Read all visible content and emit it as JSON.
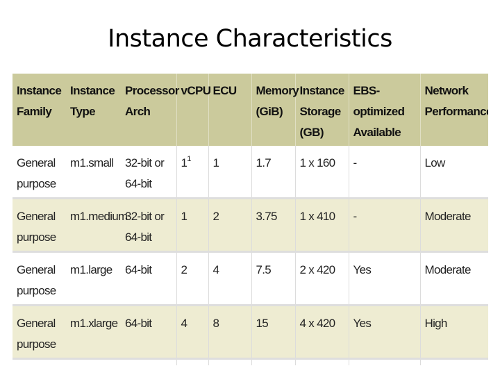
{
  "slide": {
    "title": "Instance Characteristics"
  },
  "table": {
    "headers": [
      "Instance Family",
      "Instance Type",
      "Processor Arch",
      "vCPU",
      "ECU",
      "Memory (GiB)",
      "Instance Storage (GB)",
      "EBS-optimized Available",
      "Network Performance"
    ],
    "rows": [
      {
        "family": "General purpose",
        "type": "m1.small",
        "arch": "32-bit or 64-bit",
        "vcpu": "1",
        "vcpu_footnote": "1",
        "ecu": "1",
        "memory": "1.7",
        "storage": "1 x 160",
        "ebs": "-",
        "network": "Low"
      },
      {
        "family": "General purpose",
        "type": "m1.medium",
        "arch": "32-bit or 64-bit",
        "vcpu": "1",
        "vcpu_footnote": "",
        "ecu": "2",
        "memory": "3.75",
        "storage": "1 x 410",
        "ebs": "-",
        "network": "Moderate"
      },
      {
        "family": "General purpose",
        "type": "m1.large",
        "arch": "64-bit",
        "vcpu": "2",
        "vcpu_footnote": "",
        "ecu": "4",
        "memory": "7.5",
        "storage": "2 x 420",
        "ebs": "Yes",
        "network": "Moderate"
      },
      {
        "family": "General purpose",
        "type": "m1.xlarge",
        "arch": "64-bit",
        "vcpu": "4",
        "vcpu_footnote": "",
        "ecu": "8",
        "memory": "15",
        "storage": "4 x 420",
        "ebs": "Yes",
        "network": "High"
      }
    ]
  },
  "colors": {
    "header_bg": "#cbca9c",
    "row_alt_bg": "#eeecd2",
    "row_bg": "#ffffff",
    "row_divider": "#dedede"
  }
}
